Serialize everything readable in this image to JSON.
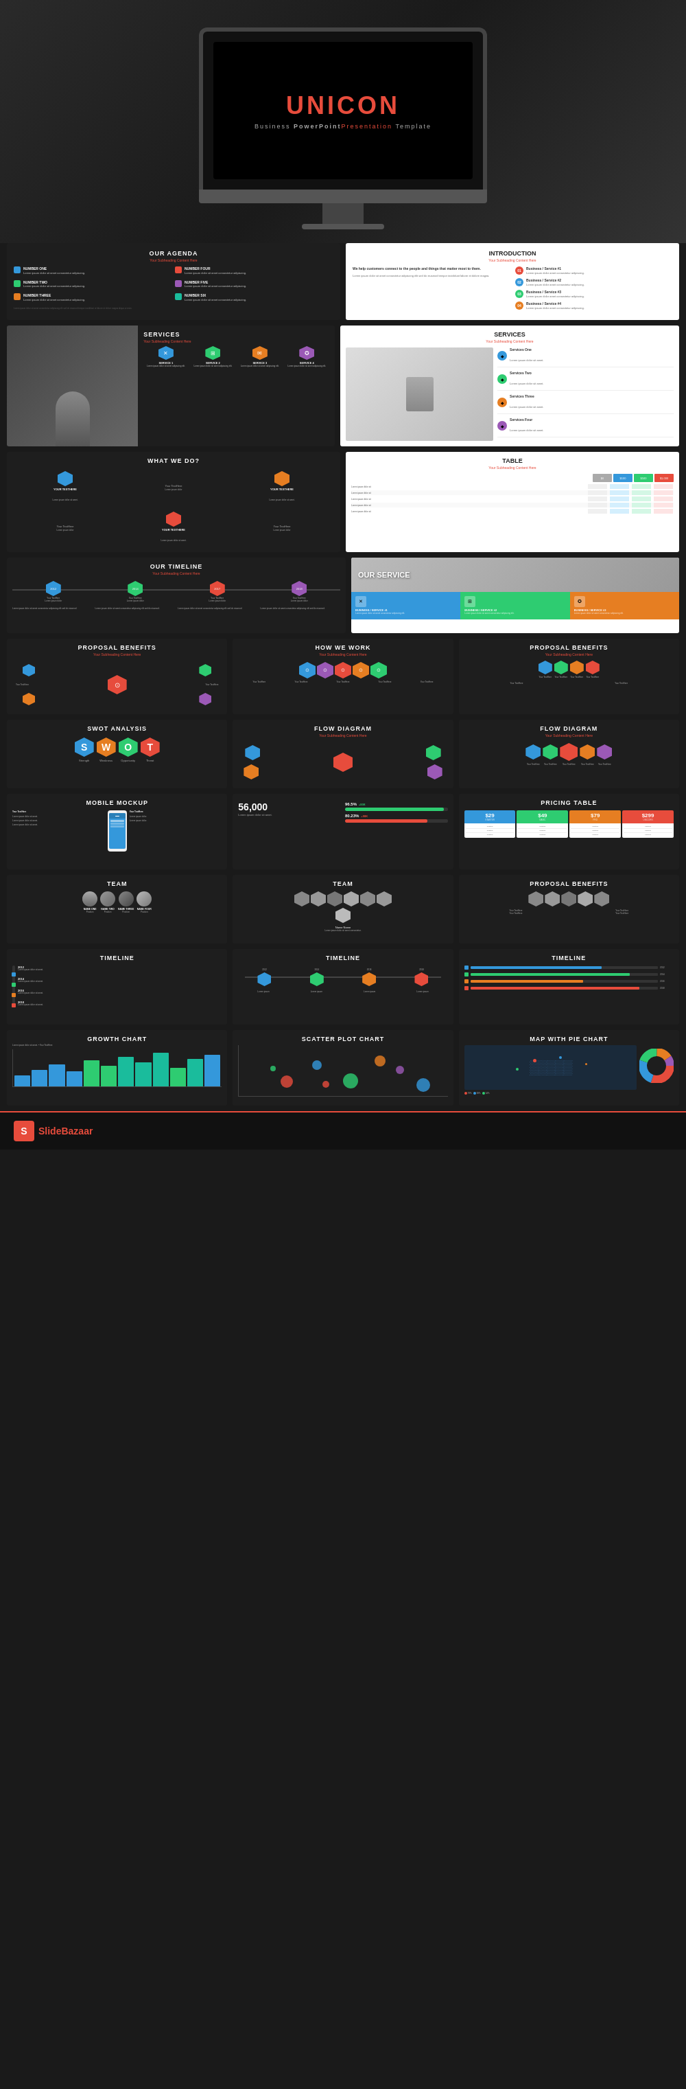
{
  "monitor": {
    "brand": "UNICO",
    "brand_highlight": "N",
    "subtitle_pre": "Business ",
    "subtitle_bold": "PowerPoint",
    "subtitle_em": "Presentation",
    "subtitle_post": " Template"
  },
  "slides": {
    "agenda": {
      "title": "OUR AGENDA",
      "subtitle": "Your Subheading Content Here",
      "items": [
        {
          "label": "NUMBER ONE",
          "text": "Lorem ipsum dolor sit amet, consectetur adipiscing elit, sed do eiusmod tempor incididunt."
        },
        {
          "label": "NUMBER TWO",
          "text": "Lorem ipsum dolor sit amet, consectetur adipiscing elit, sed do eiusmod tempor incididunt."
        },
        {
          "label": "NUMBER THREE",
          "text": "Lorem ipsum dolor sit amet, consectetur adipiscing elit, sed do eiusmod tempor incididunt."
        },
        {
          "label": "NUMBER FOUR",
          "text": "Lorem ipsum dolor sit amet, consectetur adipiscing elit, sed do eiusmod tempor incididunt."
        },
        {
          "label": "NUMBER FIVE",
          "text": "Lorem ipsum dolor sit amet, consectetur adipiscing elit, sed do eiusmod tempor incididunt."
        },
        {
          "label": "NUMBER SIX",
          "text": "Lorem ipsum dolor sit amet, consectetur adipiscing elit, sed do eiusmod tempor incididunt."
        }
      ]
    },
    "introduction": {
      "title": "INTRODUCTION",
      "subtitle": "Your Subheading Content Here",
      "main_text": "We help customers connect to the people and things that matter most to them.",
      "services": [
        {
          "num": "01",
          "name": "Business / Service #1",
          "text": "Lorem ipsum dolor sit amet, consectetur adipiscing elit."
        },
        {
          "num": "02",
          "name": "Business / Service #2",
          "text": "Lorem ipsum dolor sit amet, consectetur adipiscing elit."
        },
        {
          "num": "03",
          "name": "Business / Service #3",
          "text": "Lorem ipsum dolor sit amet, consectetur adipiscing elit."
        },
        {
          "num": "04",
          "name": "Business / Service #4",
          "text": "Lorem ipsum dolor sit amet, consectetur adipiscing elit."
        }
      ]
    },
    "services_dark": {
      "title": "SERVICES",
      "subtitle": "Your Subheading Content Here",
      "cards": [
        {
          "title": "SERVICE 1",
          "color": "#3498db",
          "icon": "✕"
        },
        {
          "title": "SERVICE 2",
          "color": "#2ecc71",
          "icon": "⊞"
        },
        {
          "title": "SERVICE 3",
          "color": "#e67e22",
          "icon": "✉"
        },
        {
          "title": "SERVICE 4",
          "color": "#9b59b6",
          "icon": "✪"
        }
      ]
    },
    "services_white": {
      "title": "SERVICES",
      "subtitle": "Your Subheading Content Here",
      "items": [
        {
          "name": "Services One",
          "color": "#3498db",
          "icon": "◆"
        },
        {
          "name": "Services Two",
          "color": "#2ecc71",
          "icon": "◆"
        },
        {
          "name": "Services Three",
          "color": "#e67e22",
          "icon": "◆"
        },
        {
          "name": "Services Four",
          "color": "#9b59b6",
          "icon": "◆"
        }
      ]
    },
    "what_we_do": {
      "title": "WHAT WE DO?",
      "items": [
        {
          "label": "Your TextHere",
          "color": "#3498db"
        },
        {
          "label": "Your TextHere",
          "color": "#2ecc71"
        },
        {
          "label": "Your TextHere",
          "color": "#e67e22"
        },
        {
          "label": "Your TextHere",
          "color": "#9b59b6"
        },
        {
          "label": "Your TextHere",
          "color": "#e74c3c"
        },
        {
          "label": "Your TextHere",
          "color": "#1abc9c"
        }
      ]
    },
    "table": {
      "title": "TABLE",
      "subtitle": "Your Subheading Content Here",
      "prices": [
        "$0",
        "$100",
        "$500",
        "$1,000"
      ],
      "colors": [
        "#aaa",
        "#3498db",
        "#2ecc71",
        "#e74c3c"
      ]
    },
    "our_timeline": {
      "title": "OUR TIMELINE",
      "subtitle": "Your Subheading Content Here",
      "years": [
        "2012",
        "2014",
        "2017",
        "2018"
      ],
      "colors": [
        "#3498db",
        "#2ecc71",
        "#e74c3c",
        "#9b59b6"
      ]
    },
    "our_service": {
      "title": "OUR SERVICE",
      "cards": [
        {
          "title": "Business / Service #1",
          "color": "#3498db",
          "icon": "✕"
        },
        {
          "title": "Business / Service #2",
          "color": "#2ecc71",
          "icon": "⊞"
        },
        {
          "title": "Business / Service #3",
          "color": "#e67e22",
          "icon": "✪"
        }
      ]
    },
    "proposal_1": {
      "title": "PROPOSAL BENEFITS",
      "subtitle": "Your Subheading Content Here"
    },
    "how_we_work": {
      "title": "HOW WE WORK",
      "subtitle": "Your Subheading Content Here",
      "colors": [
        "#3498db",
        "#9b59b6",
        "#e74c3c",
        "#e67e22",
        "#2ecc71"
      ]
    },
    "proposal_2": {
      "title": "PROPOSAL BENEFITS",
      "subtitle": "Your Subheading Content Here"
    },
    "swot": {
      "title": "SWOT ANALYSIS",
      "letters": [
        "S",
        "W",
        "O",
        "T"
      ],
      "colors": [
        "#3498db",
        "#e67e22",
        "#2ecc71",
        "#e74c3c"
      ],
      "labels": [
        "Strength",
        "Weakness",
        "Opportunity",
        "Threat"
      ]
    },
    "flow_1": {
      "title": "FLOW DIAGRAM",
      "subtitle": "Your Subheading Content Here",
      "colors": [
        "#3498db",
        "#2ecc71",
        "#e67e22",
        "#9b59b6",
        "#e74c3c"
      ]
    },
    "flow_2": {
      "title": "FLOW DIAGRAM",
      "subtitle": "Your Subheading Content Here",
      "colors": [
        "#3498db",
        "#2ecc71",
        "#e67e22",
        "#9b59b6",
        "#e74c3c"
      ]
    },
    "mobile_mockup": {
      "title": "MOBILE MOCKUP",
      "subtitle": "Your TextHere",
      "stats": [
        "Your TextHere",
        "Your TextHere",
        "Your TextHere"
      ]
    },
    "stats": {
      "big_number": "56,000",
      "stats": [
        {
          "value": "96.5%",
          "change": "+93K"
        },
        {
          "value": "80.23%",
          "change": "+98K"
        }
      ]
    },
    "pricing": {
      "title": "PRICING TABLE",
      "plans": [
        {
          "price": "$29",
          "name": "STARTER",
          "color": "#3498db"
        },
        {
          "price": "$49",
          "name": "BASIC",
          "color": "#2ecc71"
        },
        {
          "price": "$79",
          "name": "PROFESSIONAL",
          "color": "#e67e22"
        },
        {
          "price": "$299",
          "name": "UNICORN",
          "color": "#e74c3c"
        }
      ]
    },
    "team_1": {
      "title": "TEAM",
      "members": [
        {
          "name": "NAME ONE",
          "role": "Position"
        },
        {
          "name": "NAME TWO",
          "role": "Position"
        },
        {
          "name": "NAME THREE",
          "role": "Position"
        },
        {
          "name": "NAME FOUR",
          "role": "Position"
        }
      ]
    },
    "team_2": {
      "title": "TEAM",
      "members": 7
    },
    "proposal_3": {
      "title": "PROPOSAL BENEFITS"
    },
    "timeline_1": {
      "title": "TIMELINE"
    },
    "timeline_2": {
      "title": "TIMELINE"
    },
    "timeline_3": {
      "title": "TIMELINE"
    },
    "growth_chart": {
      "title": "GROWTH CHART",
      "bars": [
        30,
        45,
        60,
        40,
        70,
        55,
        80,
        65,
        90,
        50,
        75,
        85
      ],
      "colors": [
        "#3498db",
        "#3498db",
        "#3498db",
        "#3498db",
        "#2ecc71",
        "#2ecc71",
        "#1abc9c",
        "#1abc9c",
        "#1abc9c",
        "#2ecc71",
        "#1abc9c",
        "#3498db"
      ]
    },
    "scatter_plot": {
      "title": "SCATTER PLOT CHART",
      "dots": [
        {
          "x": 20,
          "y": 60,
          "size": 18,
          "color": "#e74c3c"
        },
        {
          "x": 35,
          "y": 30,
          "size": 14,
          "color": "#3498db"
        },
        {
          "x": 50,
          "y": 55,
          "size": 22,
          "color": "#2ecc71"
        },
        {
          "x": 65,
          "y": 20,
          "size": 16,
          "color": "#e67e22"
        },
        {
          "x": 75,
          "y": 40,
          "size": 12,
          "color": "#9b59b6"
        },
        {
          "x": 40,
          "y": 70,
          "size": 10,
          "color": "#e74c3c"
        },
        {
          "x": 15,
          "y": 40,
          "size": 8,
          "color": "#2ecc71"
        },
        {
          "x": 85,
          "y": 65,
          "size": 20,
          "color": "#3498db"
        }
      ]
    },
    "map_pie": {
      "title": "MAP WITH PIE CHART",
      "pie_segments": [
        {
          "percent": 30,
          "color": "#e74c3c"
        },
        {
          "percent": 25,
          "color": "#3498db"
        },
        {
          "percent": 20,
          "color": "#2ecc71"
        },
        {
          "percent": 15,
          "color": "#e67e22"
        },
        {
          "percent": 10,
          "color": "#9b59b6"
        }
      ]
    }
  },
  "footer": {
    "logo_letter": "S",
    "brand": "Slide",
    "brand_highlight": "Bazaar"
  }
}
